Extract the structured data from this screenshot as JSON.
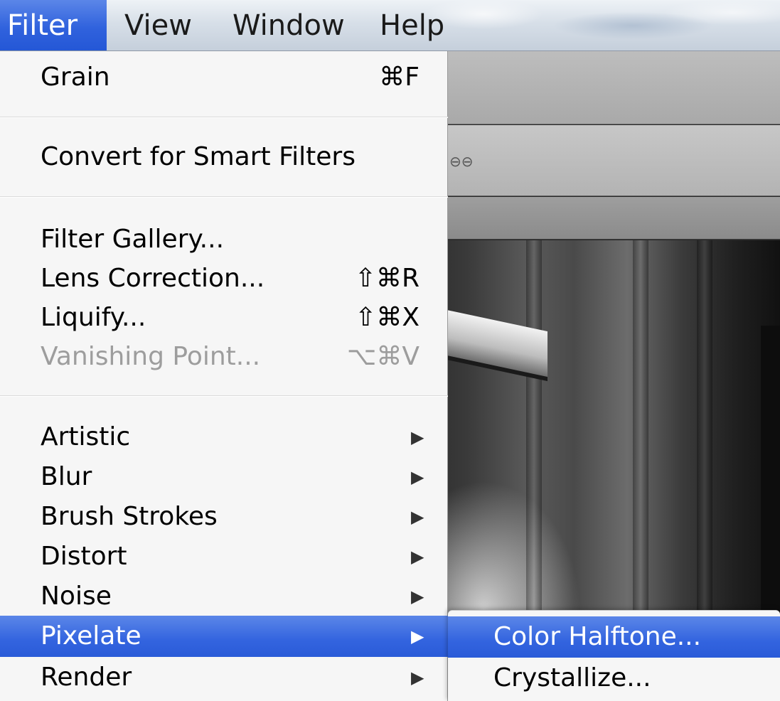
{
  "menubar": {
    "items": [
      {
        "label": "Filter",
        "active": true
      },
      {
        "label": "View",
        "active": false
      },
      {
        "label": "Window",
        "active": false
      },
      {
        "label": "Help",
        "active": false
      }
    ]
  },
  "filter_menu": {
    "items": [
      {
        "label": "Grain",
        "shortcut": "⌘F",
        "enabled": true
      },
      {
        "label": "Convert for Smart Filters",
        "shortcut": "",
        "enabled": true
      },
      {
        "label": "Filter Gallery...",
        "shortcut": "",
        "enabled": true
      },
      {
        "label": "Lens Correction...",
        "shortcut": "⇧⌘R",
        "enabled": true
      },
      {
        "label": "Liquify...",
        "shortcut": "⇧⌘X",
        "enabled": true
      },
      {
        "label": "Vanishing Point...",
        "shortcut": "⌥⌘V",
        "enabled": false
      },
      {
        "label": "Artistic",
        "submenu": true
      },
      {
        "label": "Blur",
        "submenu": true
      },
      {
        "label": "Brush Strokes",
        "submenu": true
      },
      {
        "label": "Distort",
        "submenu": true
      },
      {
        "label": "Noise",
        "submenu": true
      },
      {
        "label": "Pixelate",
        "submenu": true,
        "highlighted": true
      },
      {
        "label": "Render",
        "submenu": true
      }
    ],
    "submenu_arrow": "▶"
  },
  "pixelate_submenu": {
    "items": [
      {
        "label": "Color Halftone...",
        "highlighted": true
      },
      {
        "label": "Crystallize...",
        "highlighted": false
      }
    ]
  },
  "app": {
    "link_icon_glyph": "⊖⊖"
  },
  "colors": {
    "highlight": "#3364df",
    "menu_background": "#f6f6f6",
    "disabled_text": "#9d9d9d"
  }
}
